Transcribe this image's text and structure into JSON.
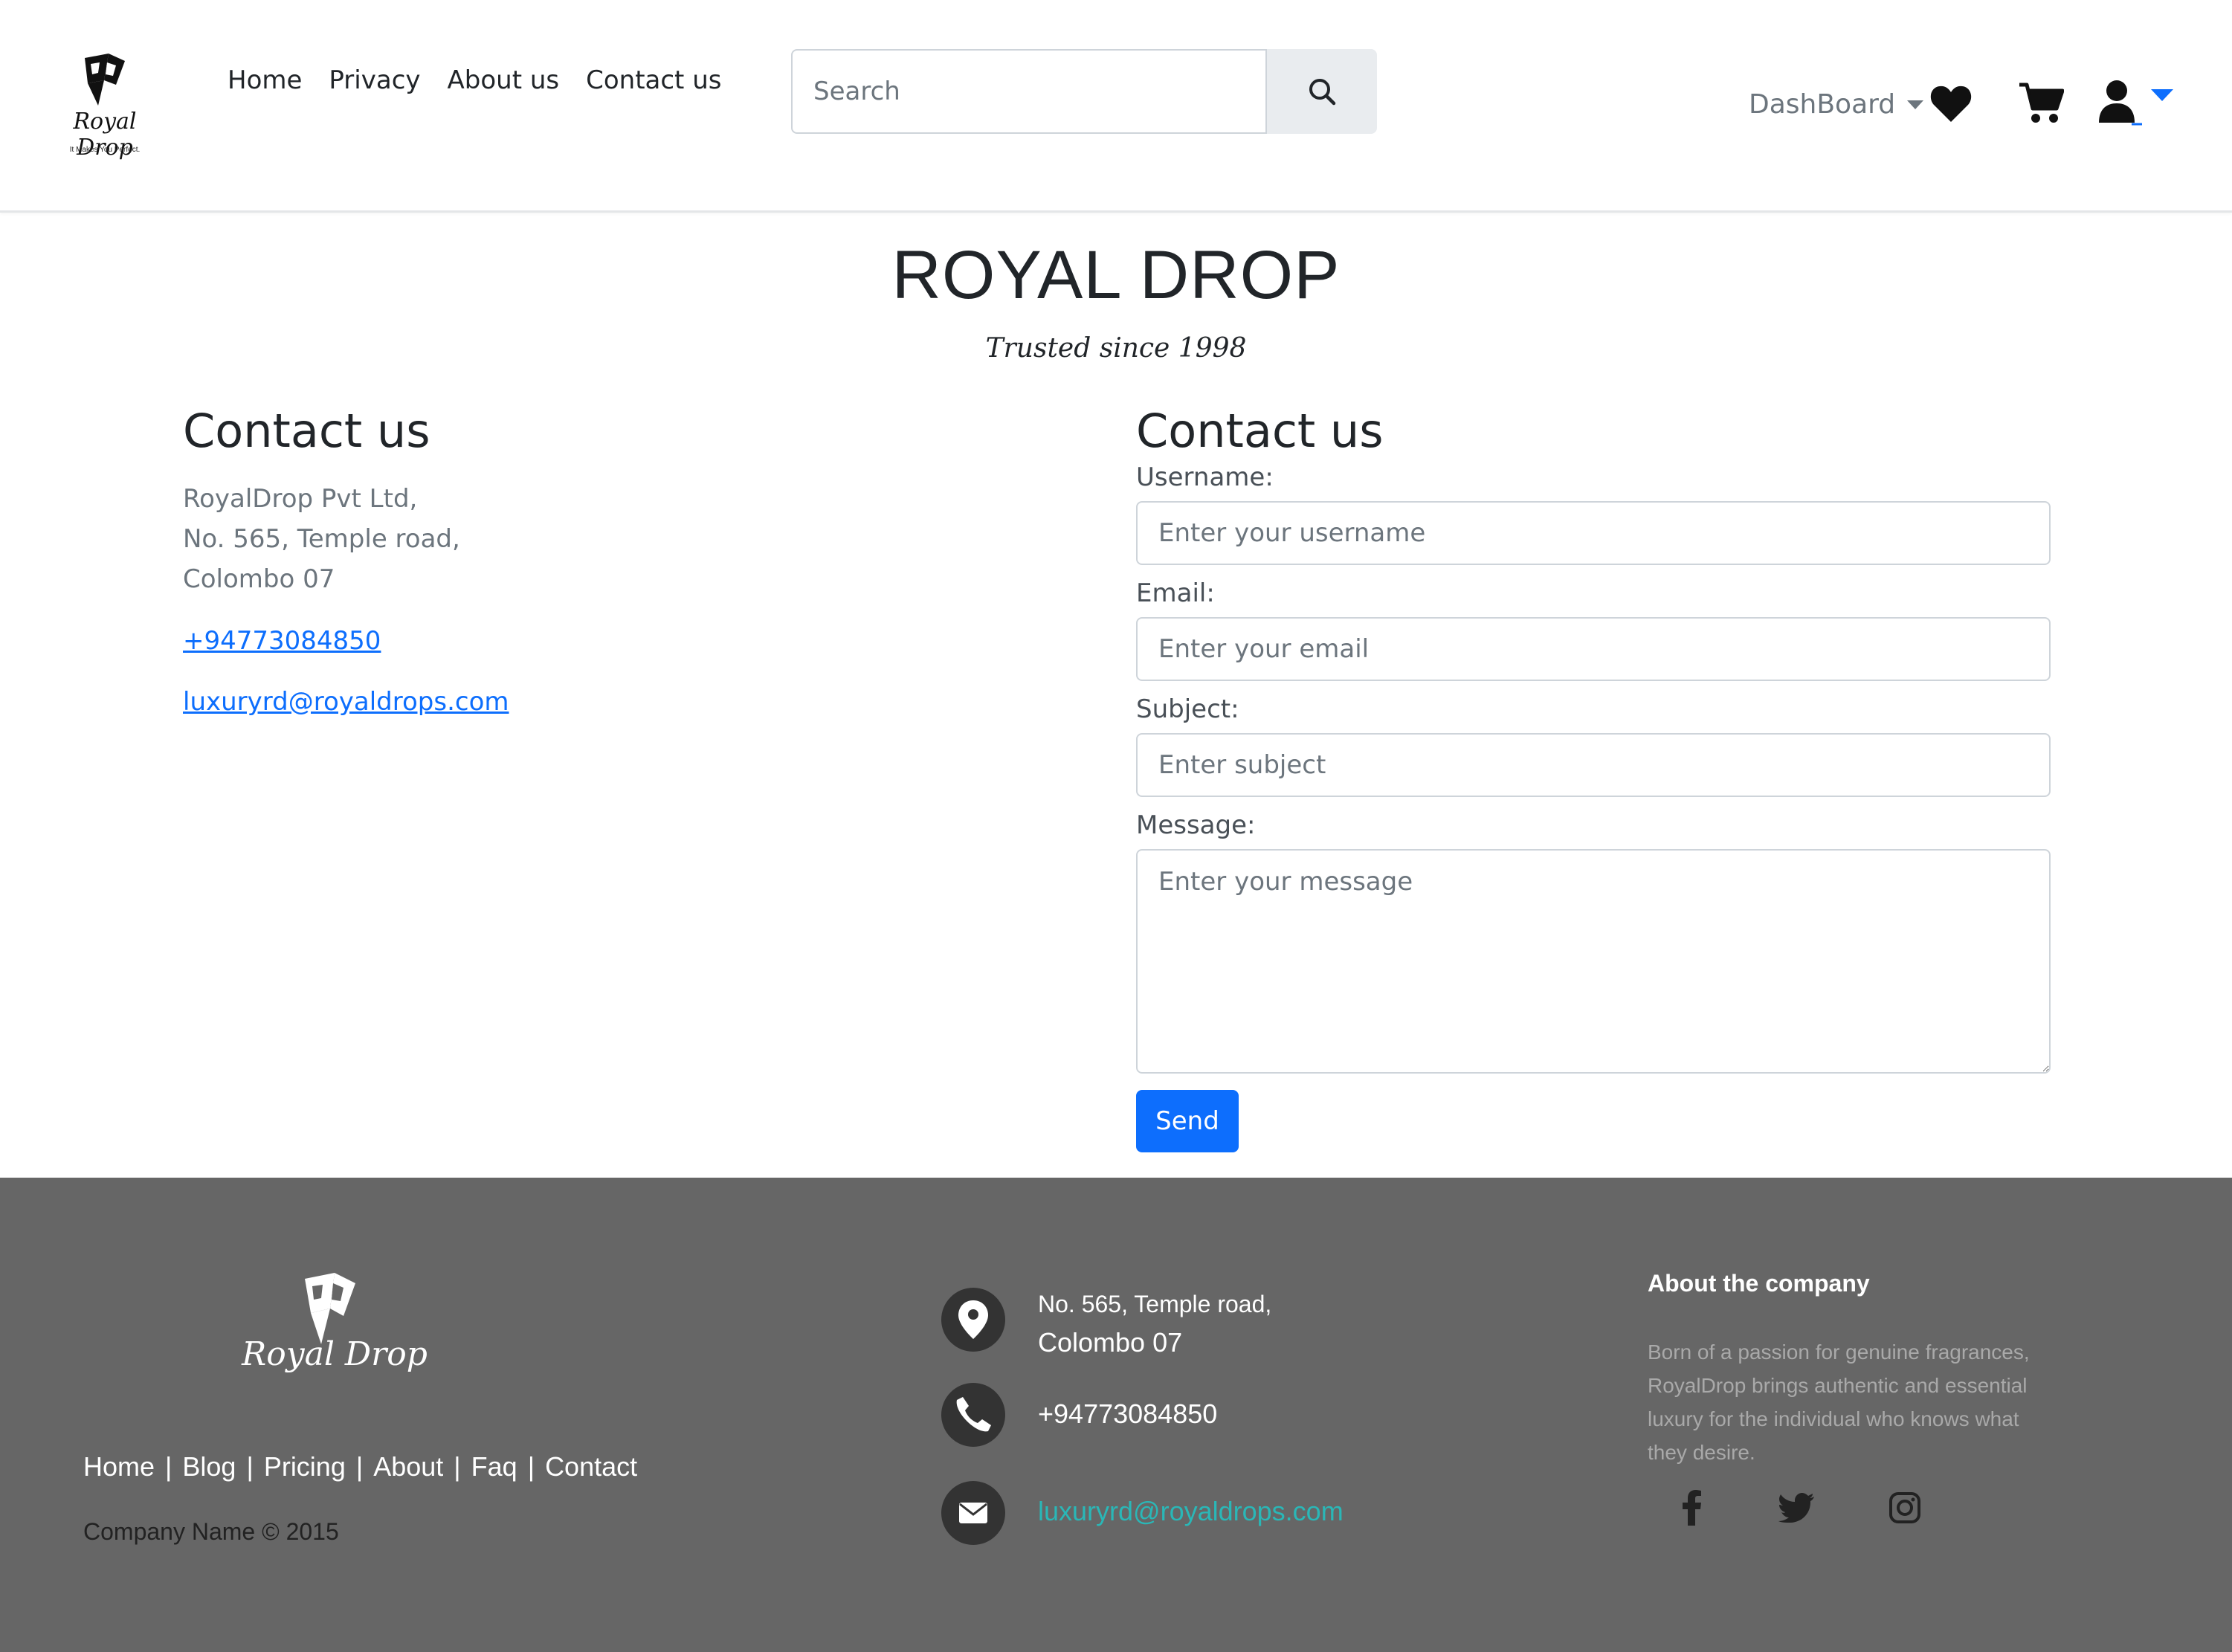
{
  "header": {
    "logo": {
      "script": "Royal Drop",
      "tagline": "It Makes You Perfect."
    },
    "nav": [
      "Home",
      "Privacy",
      "About us",
      "Contact us"
    ],
    "search": {
      "placeholder": "Search"
    },
    "dashboard_label": "DashBoard",
    "icons": [
      "heart-icon",
      "cart-icon",
      "user-icon"
    ],
    "accent": "#0d6efd"
  },
  "main": {
    "brand_title": "ROYAL DROP",
    "brand_subtitle": "Trusted since 1998",
    "contact_info": {
      "heading": "Contact us",
      "address_lines": [
        "RoyalDrop Pvt Ltd,",
        "No. 565, Temple road,",
        "Colombo 07"
      ],
      "phone": "+94773084850",
      "email": "luxuryrd@royaldrops.com"
    },
    "form": {
      "heading": "Contact us",
      "username_label": "Username:",
      "username_placeholder": "Enter your username",
      "email_label": "Email:",
      "email_placeholder": "Enter your email",
      "subject_label": "Subject:",
      "subject_placeholder": "Enter subject",
      "message_label": "Message:",
      "message_placeholder": "Enter your message",
      "send_label": "Send"
    }
  },
  "footer": {
    "logo_script": "Royal Drop",
    "links": [
      "Home",
      "Blog",
      "Pricing",
      "About",
      "Faq",
      "Contact"
    ],
    "copyright": "Company Name © 2015",
    "address_line1": "No. 565, Temple road,",
    "address_line2": "Colombo 07",
    "phone": "+94773084850",
    "email": "luxuryrd@royaldrops.com",
    "about_heading": "About the company",
    "about_text": "Born of a passion for genuine fragrances, RoyalDrop brings authentic and essential luxury for the individual who knows what they desire.",
    "social": [
      "facebook-icon",
      "twitter-icon",
      "instagram-icon"
    ],
    "background": "#666666"
  }
}
